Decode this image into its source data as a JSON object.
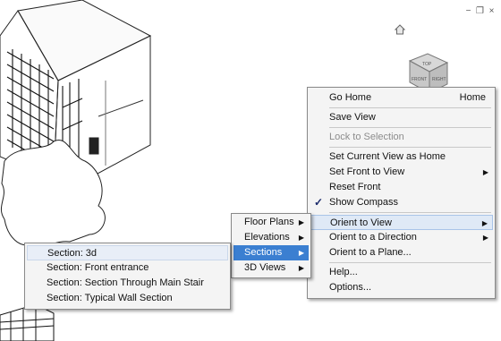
{
  "window_controls": [
    "−",
    "❐",
    "×"
  ],
  "viewcube": {
    "top": "TOP",
    "front": "FRONT",
    "right": "RIGHT"
  },
  "main_menu": {
    "go_home": "Go Home",
    "go_home_shortcut": "Home",
    "save_view": "Save View",
    "lock_to_selection": "Lock to Selection",
    "set_current_view_as_home": "Set Current View as Home",
    "set_front_to_view": "Set Front to View",
    "reset_front": "Reset Front",
    "show_compass": "Show Compass",
    "show_compass_checked": "✓",
    "orient_to_view": "Orient to View",
    "orient_to_direction": "Orient to a Direction",
    "orient_to_plane": "Orient to a Plane...",
    "help": "Help...",
    "options": "Options..."
  },
  "orient_submenu": {
    "floor_plans": "Floor Plans",
    "elevations": "Elevations",
    "sections": "Sections",
    "views_3d": "3D Views"
  },
  "sections_submenu": {
    "items": [
      "Section: 3d",
      "Section: Front entrance",
      "Section: Section Through Main Stair",
      "Section: Typical Wall Section"
    ]
  },
  "arrow_glyph": "▶"
}
